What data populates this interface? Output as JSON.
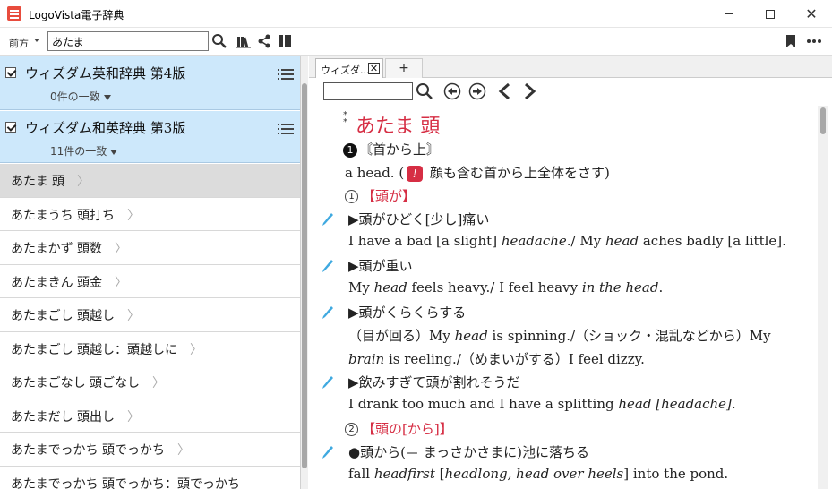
{
  "window": {
    "title": "LogoVista電子辞典"
  },
  "toolbar": {
    "direction_label": "前方",
    "search_value": "あたま"
  },
  "dictionaries": [
    {
      "name": "ウィズダム英和辞典 第4版",
      "count": "0件の一致",
      "checked": true
    },
    {
      "name": "ウィズダム和英辞典 第3版",
      "count": "11件の一致",
      "checked": true
    }
  ],
  "results": [
    "あたま 頭",
    "あたまうち 頭打ち",
    "あたまかず 頭数",
    "あたまきん 頭金",
    "あたまごし 頭越し",
    "あたまごし 頭越し：頭越しに",
    "あたまごなし 頭ごなし",
    "あたまだし 頭出し",
    "あたまでっかち 頭でっかち",
    "あたまでっかち 頭でっかち：頭でっかち"
  ],
  "tabs": {
    "active_label": "ウィズダ...",
    "close_glyph": "✕",
    "add_label": "+"
  },
  "entry": {
    "headword": "あたま 頭",
    "sense1_num": "1",
    "sense1_label": "〘首から上〙",
    "sense1_def_pre": "a head. (",
    "sense1_note_icon": "!",
    "sense1_def_post": " 顔も含む首から上全体をさす)",
    "sub1_num": "1",
    "sub1_label": "【頭が】",
    "ex1_ja": "▶頭がひどく[少し]痛い",
    "ex1_en": [
      "I have a bad [a slight] ",
      "headache",
      "./ My ",
      "head",
      " aches badly [a little]."
    ],
    "ex2_ja": "▶頭が重い",
    "ex2_en": [
      "My ",
      "head",
      " feels heavy./ I feel heavy ",
      "in the head",
      "."
    ],
    "ex3_ja": "▶頭がくらくらする",
    "ex3_en1": [
      "（目が回る）My ",
      "head",
      " is spinning./（ショック・混乱などから）My"
    ],
    "ex3_en2": [
      "brain",
      " is reeling./（めまいがする）I feel dizzy."
    ],
    "ex4_ja": "▶飲みすぎて頭が割れそうだ",
    "ex4_en": [
      "I drank too much and I have a splitting ",
      "head [headache]",
      "."
    ],
    "sub2_num": "2",
    "sub2_label": "【頭の[から]】",
    "ex5_ja": "●頭から(＝ まっさかさまに)池に落ちる",
    "ex5_en": [
      "fall ",
      "headfirst",
      " [",
      "headlong, head over heels",
      "] into the pond."
    ]
  }
}
